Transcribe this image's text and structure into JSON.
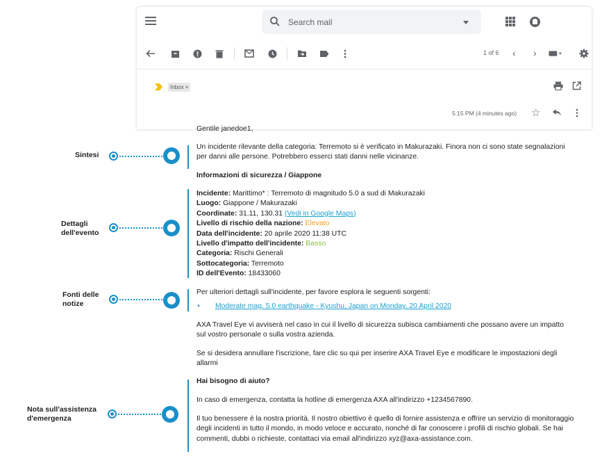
{
  "search": {
    "placeholder": "Search mail"
  },
  "toolbar": {
    "count": "1 of 6"
  },
  "message": {
    "label": "Inbox ×",
    "time": "5:15 PM (4 minutes ago)"
  },
  "email": {
    "greeting": "Gentile janedoe1,",
    "summary": "Un incidente rilevante della categoria: Terremoto si è verificato in Makurazaki. Finora non ci sono state segnalazioni per danni alle persone. Potrebbero esserci stati danni nelle vicinanze.",
    "security_heading": "Informazioni di sicurezza / Giappone",
    "details": {
      "incident_label": "Incidente:",
      "incident_value": " Marittimo* : Terremoto di magnitudo 5.0 a sud di Makurazaki",
      "place_label": "Luogo:",
      "place_value": " Giappone / Makurazaki",
      "coords_label": "Coordinate:",
      "coords_value": " 31.11, 130.31 ",
      "maps_link": "(Vedi in Google Maps)",
      "risk_label": "Livello di rischio della nazione:",
      "risk_value": " Elevato",
      "date_label": "Data dell'incidente:",
      "date_value": " 20 aprile 2020 11:38 UTC",
      "impact_label": "Livello d'impatto dell'incidente:",
      "impact_value": " Basso",
      "category_label": "Categoria:",
      "category_value": " Rischi Generali",
      "subcategory_label": "Sottocategoria:",
      "subcategory_value": " Terremoto",
      "id_label": "ID dell'Evento:",
      "id_value": " 18433060"
    },
    "sources_intro": "Per ulteriori dettagli sull'incidente, per favore esplora le seguenti sorgenti:",
    "source_link": "Moderate mag. 5.0 earthquake - Kyushu, Japan on Monday, 20 April 2020",
    "notify": "AXA Travel Eye vi avviserà nel caso in cui il livello di sicurezza subisca cambiamenti che possano avere un impatto sul vostro personale o sulla vostra azienda.",
    "unsubscribe": "Se si desidera annullare l'iscrizione, fare clic su qui per inserire AXA Travel Eye e modificare le impostazioni degli allarmi",
    "help_heading": "Hai bisogno di aiuto?",
    "emergency": "In caso di emergenza, contatta la hotline di emergenza AXA all'indirizzo +1234567890.",
    "wellbeing": "Il tuo benessere è la nostra priorità. Il nostro obiettivo è quello di fornire assistenza e offrire un servizio di monitoraggio degli incidenti in tutto il mondo, in modo veloce e accurato, nonché di far conoscere i profili di rischio globali. Se hai commenti, dubbi o richieste, contattaci via email all'indirizzo xyz@axa-assistance.com."
  },
  "annotations": {
    "summary": "Sintesi",
    "details": "Dettagli dell'evento",
    "sources": "Fonti delle notize",
    "emergency": "Nota sull'assistenza d'emergenza"
  },
  "colors": {
    "accent": "#1a8fc9",
    "risk": "#f0a020",
    "impact": "#86bf3c",
    "link": "#1a9fcf"
  }
}
